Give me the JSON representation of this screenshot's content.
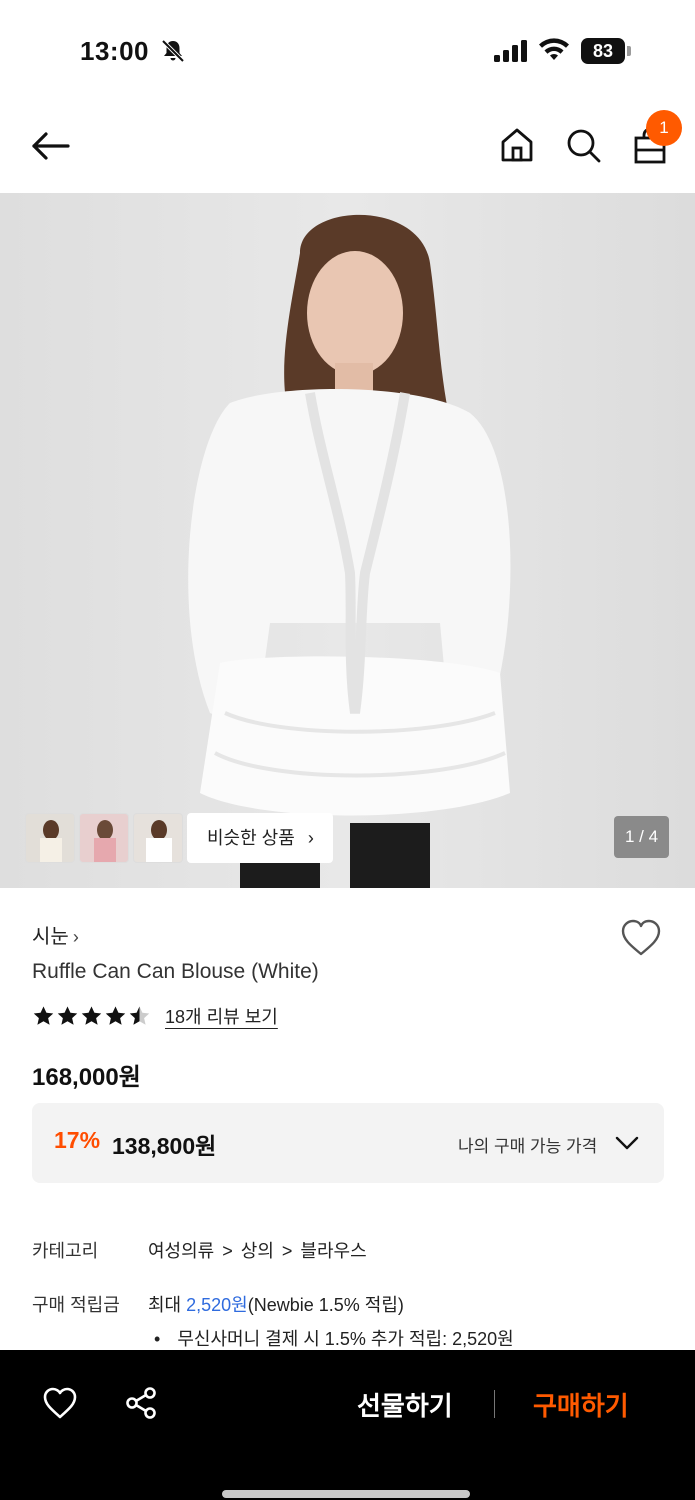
{
  "status_bar": {
    "time": "13:00",
    "battery": "83"
  },
  "nav": {
    "cart_count": "1"
  },
  "gallery": {
    "similar_label": "비슷한 상품",
    "counter": "1 / 4"
  },
  "product": {
    "brand": "시눈",
    "title": "Ruffle Can Can Blouse (White)",
    "rating": 4.5,
    "review_link": "18개 리뷰 보기",
    "price": "168,000원"
  },
  "discount": {
    "rate": "17%",
    "price": "138,800원",
    "my_price_label": "나의 구매 가능 가격"
  },
  "info": {
    "category_label": "카테고리",
    "category_path": [
      "여성의류",
      "상의",
      "블라우스"
    ],
    "points_label": "구매 적립금",
    "points_prefix": "최대",
    "points_amount": "2,520원",
    "points_suffix": "(Newbie 1.5% 적립)",
    "points_bullet": "무신사머니 결제 시 1.5% 추가 적립: 2,520원"
  },
  "bottom_bar": {
    "gift_label": "선물하기",
    "buy_label": "구매하기"
  },
  "colors": {
    "accent": "#ff5a00",
    "discount": "#ff4d00",
    "link_blue": "#2f6bde"
  }
}
